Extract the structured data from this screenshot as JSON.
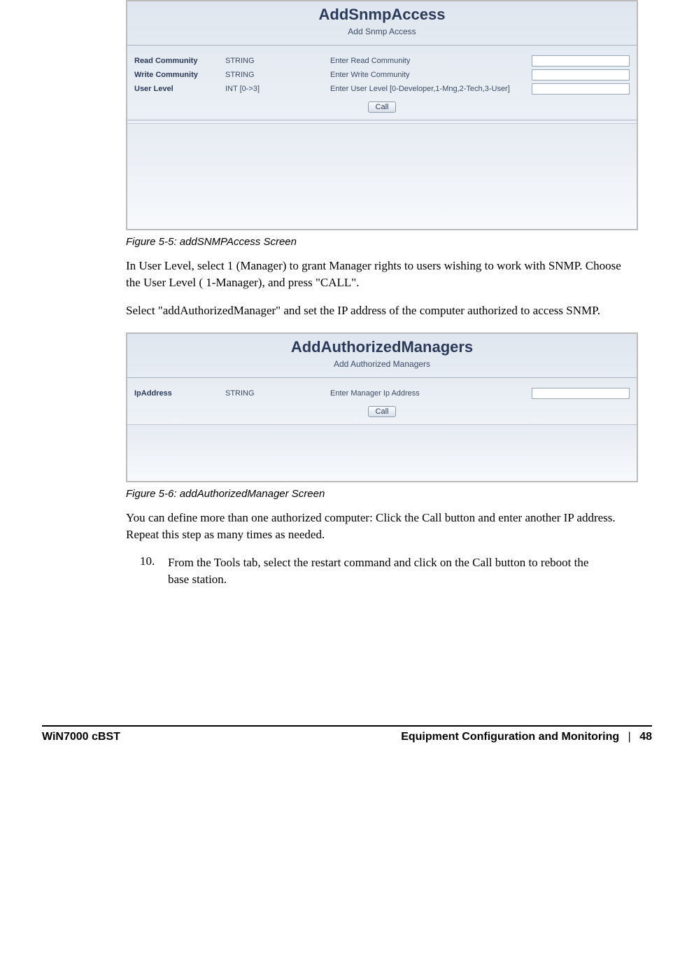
{
  "fig1": {
    "title": "AddSnmpAccess",
    "subtitle": "Add Snmp Access",
    "rows": [
      {
        "label": "Read Community",
        "type": "STRING",
        "desc": "Enter Read Community"
      },
      {
        "label": "Write Community",
        "type": "STRING",
        "desc": "Enter Write Community"
      },
      {
        "label": "User Level",
        "type": "INT [0->3]",
        "desc": "Enter User Level [0-Developer,1-Mng,2-Tech,3-User]"
      }
    ],
    "call": "Call",
    "caption": "Figure 5-5: addSNMPAccess Screen"
  },
  "para1": "In User Level, select 1 (Manager) to grant Manager rights to users wishing to work with SNMP. Choose the User Level ( 1-Manager), and press \"CALL\".",
  "para2": "Select \"addAuthorizedManager\" and set the IP address of the computer authorized to access SNMP.",
  "fig2": {
    "title": "AddAuthorizedManagers",
    "subtitle": "Add Authorized Managers",
    "rows": [
      {
        "label": "IpAddress",
        "type": "STRING",
        "desc": "Enter Manager Ip Address"
      }
    ],
    "call": "Call",
    "caption": "Figure 5-6: addAuthorizedManager Screen"
  },
  "para3": "You can define more than one authorized computer: Click the Call button and enter another IP address. Repeat this step as many times as needed.",
  "item10": {
    "num": "10.",
    "text": "From the Tools tab, select the restart command and click on the Call button to reboot the base station."
  },
  "footer": {
    "left": "WiN7000 cBST",
    "right_title": "Equipment Configuration and Monitoring",
    "sep": "|",
    "page": "48"
  }
}
